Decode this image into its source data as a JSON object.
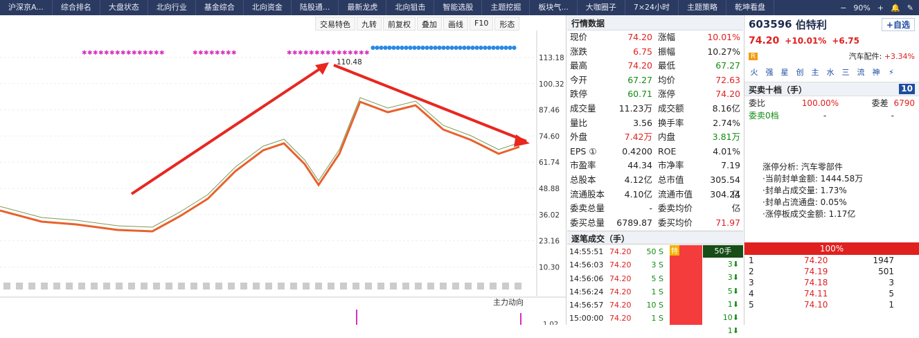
{
  "topbar": {
    "tabs": [
      "沪深京A...",
      "综合排名",
      "大盘状态",
      "北向行业",
      "基金综合",
      "北向资金",
      "陆股通...",
      "最新龙虎",
      "北向狙击",
      "智能选股",
      "主题挖掘",
      "板块气...",
      "大咖圈子",
      "7×24小时",
      "主题策略",
      "乾坤看盘"
    ],
    "zoom": "90%"
  },
  "chart": {
    "toolbar": [
      "交易特色",
      "九转",
      "前复权",
      "叠加",
      "画线",
      "F10",
      "形态"
    ],
    "yticks": [
      "113.18",
      "100.32",
      "87.46",
      "74.60",
      "61.74",
      "48.88",
      "36.02",
      "23.16",
      "10.30"
    ],
    "peak_label": "110.48",
    "indicator": "主力动向",
    "sub_tick": "1.02"
  },
  "quote": {
    "header": "行情数据",
    "rows": [
      [
        "现价",
        "74.20",
        "red",
        "涨幅",
        "10.01%",
        "red"
      ],
      [
        "涨跌",
        "6.75",
        "red",
        "振幅",
        "10.27%",
        "blk"
      ],
      [
        "最高",
        "74.20",
        "red",
        "最低",
        "67.27",
        "green"
      ],
      [
        "今开",
        "67.27",
        "green",
        "均价",
        "72.63",
        "red"
      ],
      [
        "跌停",
        "60.71",
        "green",
        "涨停",
        "74.20",
        "red"
      ],
      [
        "成交量",
        "11.23万",
        "blk",
        "成交额",
        "8.16亿",
        "blk"
      ],
      [
        "量比",
        "3.56",
        "blk",
        "换手率",
        "2.74%",
        "blk"
      ],
      [
        "外盘",
        "7.42万",
        "red",
        "内盘",
        "3.81万",
        "green"
      ],
      [
        "EPS ①",
        "0.4200",
        "blk",
        "ROE",
        "4.01%",
        "blk"
      ],
      [
        "市盈率",
        "44.34",
        "blk",
        "市净率",
        "7.19",
        "blk"
      ],
      [
        "总股本",
        "4.12亿",
        "blk",
        "总市值",
        "305.54亿",
        "blk"
      ],
      [
        "流通股本",
        "4.10亿",
        "blk",
        "流通市值",
        "304.24亿",
        "blk"
      ],
      [
        "委卖总量",
        "-",
        "blk",
        "委卖均价",
        "-",
        "blk"
      ],
      [
        "委买总量",
        "6789.87",
        "blk",
        "委买均价",
        "71.97",
        "red"
      ]
    ]
  },
  "ticks": {
    "header": "逐笔成交（手）",
    "tag": "特",
    "vol_header": "50手",
    "rows": [
      [
        "14:55:51",
        "74.20",
        "50 S",
        "3⬇"
      ],
      [
        "14:56:03",
        "74.20",
        "3 S",
        "3⬇"
      ],
      [
        "14:56:06",
        "74.20",
        "5 S",
        "5⬇"
      ],
      [
        "14:56:24",
        "74.20",
        "1 S",
        "1⬇"
      ],
      [
        "14:56:57",
        "74.20",
        "10 S",
        "10⬇"
      ],
      [
        "15:00:00",
        "74.20",
        "1 S",
        "1⬇"
      ]
    ]
  },
  "right": {
    "code": "603596",
    "name": "伯特利",
    "add": "自选",
    "price": "74.20",
    "chg": "+10.01%",
    "chg_abs": "+6.75",
    "sector": "汽车配件",
    "sector_chg": "+3.34%",
    "badge": "R",
    "cats": [
      "火",
      "强",
      "星",
      "创",
      "主",
      "水",
      "三",
      "流",
      "神",
      "⚡"
    ],
    "book_title": "买卖十档（手）",
    "book_btn": "10",
    "weibi_label": "委比",
    "weibi": "100.00%",
    "weicha_label": "委差",
    "weicha": "6790",
    "sell0": "委卖0档",
    "dash": "-",
    "zt_lines": [
      "涨停分析: 汽车零部件",
      "·当前封单金额: 1444.58万",
      "·封单占成交量: 1.73%",
      "·封单占流通盘: 0.05%",
      "·涨停板成交金额: 1.17亿"
    ],
    "pct": "100%",
    "levels": [
      [
        "1",
        "74.20",
        "1947"
      ],
      [
        "2",
        "74.19",
        "501"
      ],
      [
        "3",
        "74.18",
        "3"
      ],
      [
        "4",
        "74.11",
        "5"
      ],
      [
        "5",
        "74.10",
        "1"
      ]
    ]
  }
}
